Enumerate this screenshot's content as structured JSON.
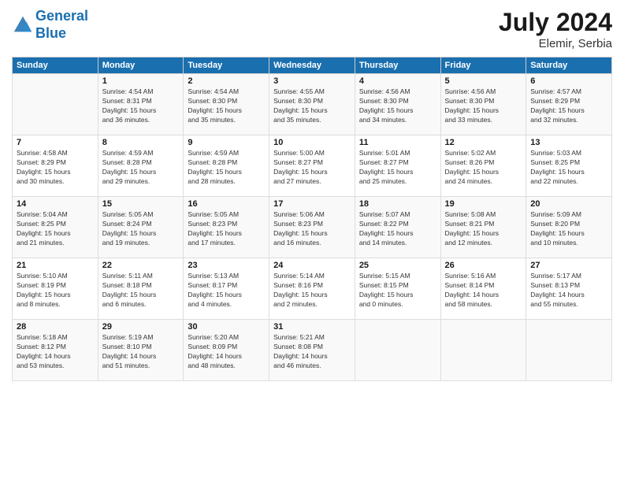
{
  "header": {
    "logo_line1": "General",
    "logo_line2": "Blue",
    "month_year": "July 2024",
    "location": "Elemir, Serbia"
  },
  "columns": [
    "Sunday",
    "Monday",
    "Tuesday",
    "Wednesday",
    "Thursday",
    "Friday",
    "Saturday"
  ],
  "weeks": [
    [
      {
        "day": "",
        "info": ""
      },
      {
        "day": "1",
        "info": "Sunrise: 4:54 AM\nSunset: 8:31 PM\nDaylight: 15 hours\nand 36 minutes."
      },
      {
        "day": "2",
        "info": "Sunrise: 4:54 AM\nSunset: 8:30 PM\nDaylight: 15 hours\nand 35 minutes."
      },
      {
        "day": "3",
        "info": "Sunrise: 4:55 AM\nSunset: 8:30 PM\nDaylight: 15 hours\nand 35 minutes."
      },
      {
        "day": "4",
        "info": "Sunrise: 4:56 AM\nSunset: 8:30 PM\nDaylight: 15 hours\nand 34 minutes."
      },
      {
        "day": "5",
        "info": "Sunrise: 4:56 AM\nSunset: 8:30 PM\nDaylight: 15 hours\nand 33 minutes."
      },
      {
        "day": "6",
        "info": "Sunrise: 4:57 AM\nSunset: 8:29 PM\nDaylight: 15 hours\nand 32 minutes."
      }
    ],
    [
      {
        "day": "7",
        "info": "Sunrise: 4:58 AM\nSunset: 8:29 PM\nDaylight: 15 hours\nand 30 minutes."
      },
      {
        "day": "8",
        "info": "Sunrise: 4:59 AM\nSunset: 8:28 PM\nDaylight: 15 hours\nand 29 minutes."
      },
      {
        "day": "9",
        "info": "Sunrise: 4:59 AM\nSunset: 8:28 PM\nDaylight: 15 hours\nand 28 minutes."
      },
      {
        "day": "10",
        "info": "Sunrise: 5:00 AM\nSunset: 8:27 PM\nDaylight: 15 hours\nand 27 minutes."
      },
      {
        "day": "11",
        "info": "Sunrise: 5:01 AM\nSunset: 8:27 PM\nDaylight: 15 hours\nand 25 minutes."
      },
      {
        "day": "12",
        "info": "Sunrise: 5:02 AM\nSunset: 8:26 PM\nDaylight: 15 hours\nand 24 minutes."
      },
      {
        "day": "13",
        "info": "Sunrise: 5:03 AM\nSunset: 8:25 PM\nDaylight: 15 hours\nand 22 minutes."
      }
    ],
    [
      {
        "day": "14",
        "info": "Sunrise: 5:04 AM\nSunset: 8:25 PM\nDaylight: 15 hours\nand 21 minutes."
      },
      {
        "day": "15",
        "info": "Sunrise: 5:05 AM\nSunset: 8:24 PM\nDaylight: 15 hours\nand 19 minutes."
      },
      {
        "day": "16",
        "info": "Sunrise: 5:05 AM\nSunset: 8:23 PM\nDaylight: 15 hours\nand 17 minutes."
      },
      {
        "day": "17",
        "info": "Sunrise: 5:06 AM\nSunset: 8:23 PM\nDaylight: 15 hours\nand 16 minutes."
      },
      {
        "day": "18",
        "info": "Sunrise: 5:07 AM\nSunset: 8:22 PM\nDaylight: 15 hours\nand 14 minutes."
      },
      {
        "day": "19",
        "info": "Sunrise: 5:08 AM\nSunset: 8:21 PM\nDaylight: 15 hours\nand 12 minutes."
      },
      {
        "day": "20",
        "info": "Sunrise: 5:09 AM\nSunset: 8:20 PM\nDaylight: 15 hours\nand 10 minutes."
      }
    ],
    [
      {
        "day": "21",
        "info": "Sunrise: 5:10 AM\nSunset: 8:19 PM\nDaylight: 15 hours\nand 8 minutes."
      },
      {
        "day": "22",
        "info": "Sunrise: 5:11 AM\nSunset: 8:18 PM\nDaylight: 15 hours\nand 6 minutes."
      },
      {
        "day": "23",
        "info": "Sunrise: 5:13 AM\nSunset: 8:17 PM\nDaylight: 15 hours\nand 4 minutes."
      },
      {
        "day": "24",
        "info": "Sunrise: 5:14 AM\nSunset: 8:16 PM\nDaylight: 15 hours\nand 2 minutes."
      },
      {
        "day": "25",
        "info": "Sunrise: 5:15 AM\nSunset: 8:15 PM\nDaylight: 15 hours\nand 0 minutes."
      },
      {
        "day": "26",
        "info": "Sunrise: 5:16 AM\nSunset: 8:14 PM\nDaylight: 14 hours\nand 58 minutes."
      },
      {
        "day": "27",
        "info": "Sunrise: 5:17 AM\nSunset: 8:13 PM\nDaylight: 14 hours\nand 55 minutes."
      }
    ],
    [
      {
        "day": "28",
        "info": "Sunrise: 5:18 AM\nSunset: 8:12 PM\nDaylight: 14 hours\nand 53 minutes."
      },
      {
        "day": "29",
        "info": "Sunrise: 5:19 AM\nSunset: 8:10 PM\nDaylight: 14 hours\nand 51 minutes."
      },
      {
        "day": "30",
        "info": "Sunrise: 5:20 AM\nSunset: 8:09 PM\nDaylight: 14 hours\nand 48 minutes."
      },
      {
        "day": "31",
        "info": "Sunrise: 5:21 AM\nSunset: 8:08 PM\nDaylight: 14 hours\nand 46 minutes."
      },
      {
        "day": "",
        "info": ""
      },
      {
        "day": "",
        "info": ""
      },
      {
        "day": "",
        "info": ""
      }
    ]
  ]
}
